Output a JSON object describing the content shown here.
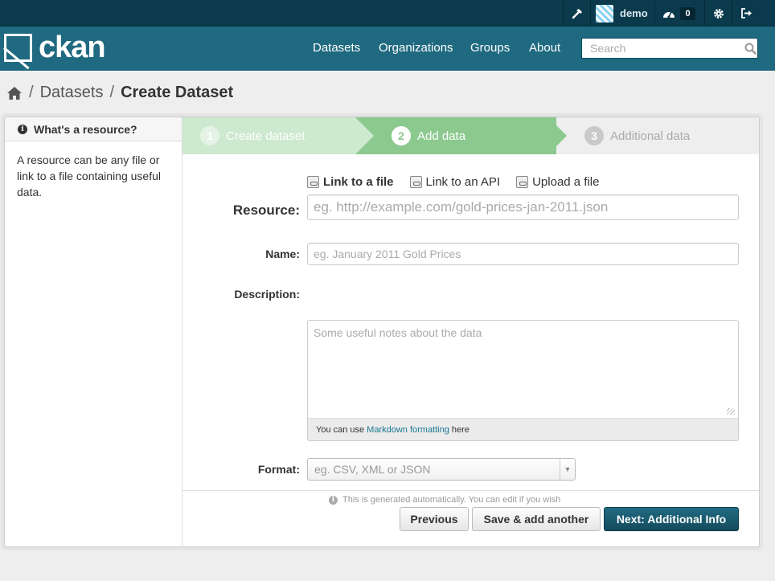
{
  "account": {
    "username": "demo",
    "dashboard_count": "0"
  },
  "brand": {
    "logo_text": "ckan"
  },
  "nav": {
    "items": [
      {
        "label": "Datasets"
      },
      {
        "label": "Organizations"
      },
      {
        "label": "Groups"
      },
      {
        "label": "About"
      }
    ],
    "search_placeholder": "Search"
  },
  "breadcrumb": {
    "sep": "/",
    "parent": "Datasets",
    "current": "Create Dataset"
  },
  "aside": {
    "title": "What's a resource?",
    "body": "A resource can be any file or link to a file containing useful data."
  },
  "stages": [
    {
      "num": "1",
      "label": "Create dataset"
    },
    {
      "num": "2",
      "label": "Add data"
    },
    {
      "num": "3",
      "label": "Additional data"
    }
  ],
  "resource_tabs": [
    {
      "label": "Link to a file"
    },
    {
      "label": "Link to an API"
    },
    {
      "label": "Upload a file"
    }
  ],
  "form": {
    "resource_label": "Resource:",
    "resource_placeholder": "eg. http://example.com/gold-prices-jan-2011.json",
    "name_label": "Name:",
    "name_placeholder": "eg. January 2011 Gold Prices",
    "description_label": "Description:",
    "description_placeholder": "Some useful notes about the data",
    "markdown_prefix": "You can use",
    "markdown_link": "Markdown formatting",
    "markdown_suffix": "here",
    "format_label": "Format:",
    "format_placeholder": "eg. CSV, XML or JSON",
    "format_help": "This is generated automatically. You can edit if you wish"
  },
  "actions": {
    "previous": "Previous",
    "save_add": "Save & add another",
    "next": "Next: Additional Info"
  },
  "colors": {
    "masthead": "#1f6a80",
    "account_bar": "#0a3a4c",
    "stage_active": "#8cc98f",
    "stage_done": "#cde9cf",
    "primary_button": "#144b5c"
  }
}
